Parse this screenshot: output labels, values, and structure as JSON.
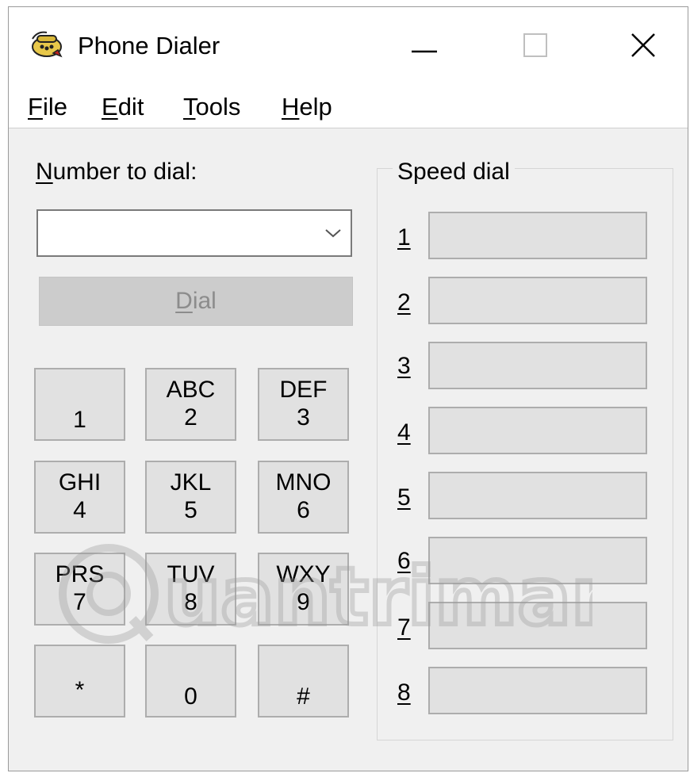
{
  "window": {
    "title": "Phone Dialer",
    "controls": {
      "minimize": "—",
      "maximize": "☐",
      "close": "✕"
    }
  },
  "menu": {
    "file": {
      "mnemonic": "F",
      "rest": "ile"
    },
    "edit": {
      "mnemonic": "E",
      "rest": "dit"
    },
    "tools": {
      "mnemonic": "T",
      "rest": "ools"
    },
    "help": {
      "mnemonic": "H",
      "rest": "elp"
    }
  },
  "dialer": {
    "number_label_mnemonic": "N",
    "number_label_rest": "umber to dial:",
    "number_value": "",
    "dial_mnemonic": "D",
    "dial_rest": "ial"
  },
  "keypad": [
    {
      "letters": "",
      "digit": "1"
    },
    {
      "letters": "ABC",
      "digit": "2"
    },
    {
      "letters": "DEF",
      "digit": "3"
    },
    {
      "letters": "GHI",
      "digit": "4"
    },
    {
      "letters": "JKL",
      "digit": "5"
    },
    {
      "letters": "MNO",
      "digit": "6"
    },
    {
      "letters": "PRS",
      "digit": "7"
    },
    {
      "letters": "TUV",
      "digit": "8"
    },
    {
      "letters": "WXY",
      "digit": "9"
    },
    {
      "letters": "",
      "digit": "*"
    },
    {
      "letters": "",
      "digit": "0"
    },
    {
      "letters": "",
      "digit": "#"
    }
  ],
  "speed_dial": {
    "title": "Speed dial",
    "numbers": [
      "1",
      "2",
      "3",
      "4",
      "5",
      "6",
      "7",
      "8"
    ]
  },
  "watermark": {
    "text": "uantrimang"
  },
  "colors": {
    "window_bg": "#f0f0f0",
    "button_face": "#e1e1e1",
    "button_border": "#adadad",
    "disabled_button": "#cccccc",
    "disabled_text": "#8c8c8c"
  }
}
